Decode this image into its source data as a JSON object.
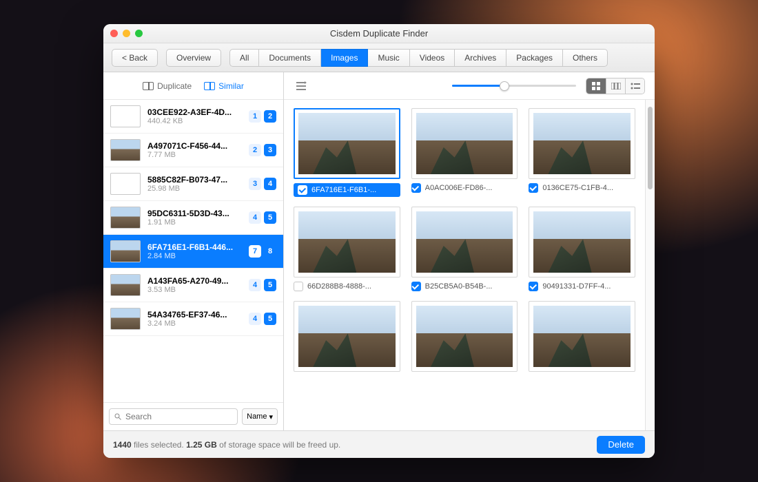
{
  "window": {
    "title": "Cisdem Duplicate Finder"
  },
  "toolbar": {
    "back": "< Back",
    "overview": "Overview",
    "categories": [
      "All",
      "Documents",
      "Images",
      "Music",
      "Videos",
      "Archives",
      "Packages",
      "Others"
    ],
    "active_category": "Images"
  },
  "sidebar": {
    "tabs": {
      "duplicate": "Duplicate",
      "similar": "Similar",
      "active": "similar"
    },
    "items": [
      {
        "name": "03CEE922-A3EF-4D...",
        "size": "440.42 KB",
        "a": "1",
        "b": "2",
        "thumb": "doc"
      },
      {
        "name": "A497071C-F456-44...",
        "size": "7.77 MB",
        "a": "2",
        "b": "3",
        "thumb": "photo"
      },
      {
        "name": "5885C82F-B073-47...",
        "size": "25.98 MB",
        "a": "3",
        "b": "4",
        "thumb": "doc"
      },
      {
        "name": "95DC6311-5D3D-43...",
        "size": "1.91 MB",
        "a": "4",
        "b": "5",
        "thumb": "photo"
      },
      {
        "name": "6FA716E1-F6B1-446...",
        "size": "2.84 MB",
        "a": "7",
        "b": "8",
        "thumb": "photo",
        "selected": true
      },
      {
        "name": "A143FA65-A270-49...",
        "size": "3.53 MB",
        "a": "4",
        "b": "5",
        "thumb": "photo"
      },
      {
        "name": "54A34765-EF37-46...",
        "size": "3.24 MB",
        "a": "4",
        "b": "5",
        "thumb": "photo"
      }
    ],
    "search_placeholder": "Search",
    "sort_label": "Name"
  },
  "grid": {
    "slider_pct": 42,
    "cards": [
      {
        "name": "6FA716E1-F6B1-...",
        "checked": true,
        "selected": true
      },
      {
        "name": "A0AC006E-FD86-...",
        "checked": true
      },
      {
        "name": "0136CE75-C1FB-4...",
        "checked": true
      },
      {
        "name": "66D288B8-4888-...",
        "checked": false
      },
      {
        "name": "B25CB5A0-B54B-...",
        "checked": true
      },
      {
        "name": "90491331-D7FF-4...",
        "checked": true
      },
      {
        "name": "",
        "checked": true,
        "partial": true
      },
      {
        "name": "",
        "checked": true,
        "partial": true
      },
      {
        "name": "",
        "checked": true,
        "partial": true
      }
    ]
  },
  "footer": {
    "count": "1440",
    "text1": "files selected.",
    "size": "1.25 GB",
    "text2": "of storage space will be freed up.",
    "delete": "Delete"
  }
}
